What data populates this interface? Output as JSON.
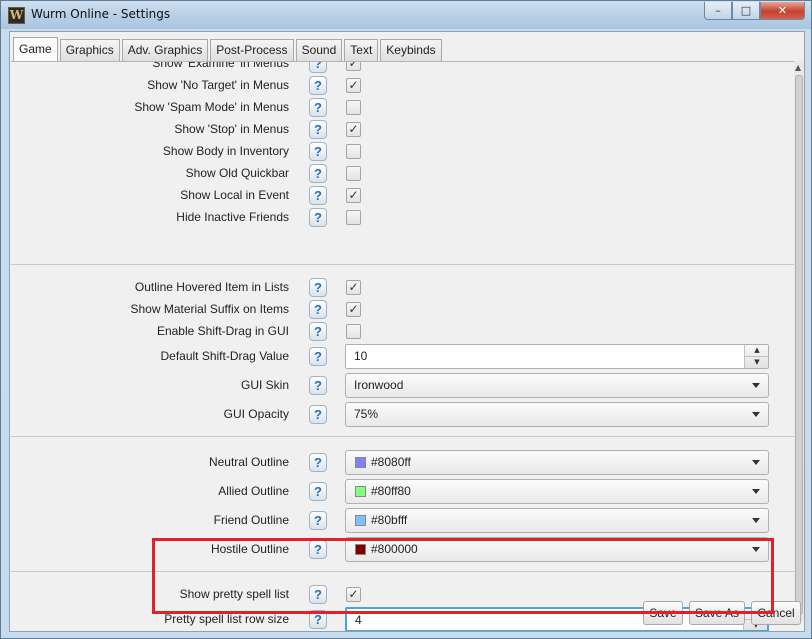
{
  "window": {
    "title": "Wurm Online - Settings",
    "app_icon_letter": "W"
  },
  "title_buttons": {
    "minimize": "–",
    "maximize": "□",
    "close": "✕"
  },
  "tabs": [
    "Game",
    "Graphics",
    "Adv. Graphics",
    "Post-Process",
    "Sound",
    "Text",
    "Keybinds"
  ],
  "active_tab": "Game",
  "help_glyph": "?",
  "check_glyph": "✓",
  "section1": [
    {
      "label": "Show 'Examine' in Menus",
      "checked": true
    },
    {
      "label": "Show 'No Target' in Menus",
      "checked": true
    },
    {
      "label": "Show 'Spam Mode' in Menus",
      "checked": false
    },
    {
      "label": "Show 'Stop' in Menus",
      "checked": true
    },
    {
      "label": "Show Body in Inventory",
      "checked": false
    },
    {
      "label": "Show Old Quickbar",
      "checked": false
    },
    {
      "label": "Show Local in Event",
      "checked": true
    },
    {
      "label": "Hide Inactive Friends",
      "checked": false
    }
  ],
  "section2": {
    "outline_hovered": {
      "label": "Outline Hovered Item in Lists",
      "checked": true
    },
    "material_suffix": {
      "label": "Show Material Suffix on Items",
      "checked": true
    },
    "shift_drag": {
      "label": "Enable Shift-Drag in GUI",
      "checked": false
    },
    "shift_drag_value": {
      "label": "Default Shift-Drag Value",
      "value": "10"
    },
    "gui_skin": {
      "label": "GUI Skin",
      "value": "Ironwood"
    },
    "gui_opacity": {
      "label": "GUI Opacity",
      "value": "75%"
    }
  },
  "section3": [
    {
      "label": "Neutral Outline",
      "value": "#8080ff",
      "color": "#8080ff"
    },
    {
      "label": "Allied Outline",
      "value": "#80ff80",
      "color": "#80ff80"
    },
    {
      "label": "Friend Outline",
      "value": "#80bfff",
      "color": "#80bfff"
    },
    {
      "label": "Hostile Outline",
      "value": "#800000",
      "color": "#800000"
    }
  ],
  "section4": {
    "pretty_spell": {
      "label": "Show pretty spell list",
      "checked": true
    },
    "pretty_row_size": {
      "label": "Pretty spell list row size",
      "value": "4"
    }
  },
  "footer": {
    "save": "Save",
    "save_as": "Save As",
    "cancel": "Cancel"
  },
  "colors": {
    "highlight": "#e0202a",
    "focus": "#4fa3d8",
    "help": "#2a6fb5"
  }
}
